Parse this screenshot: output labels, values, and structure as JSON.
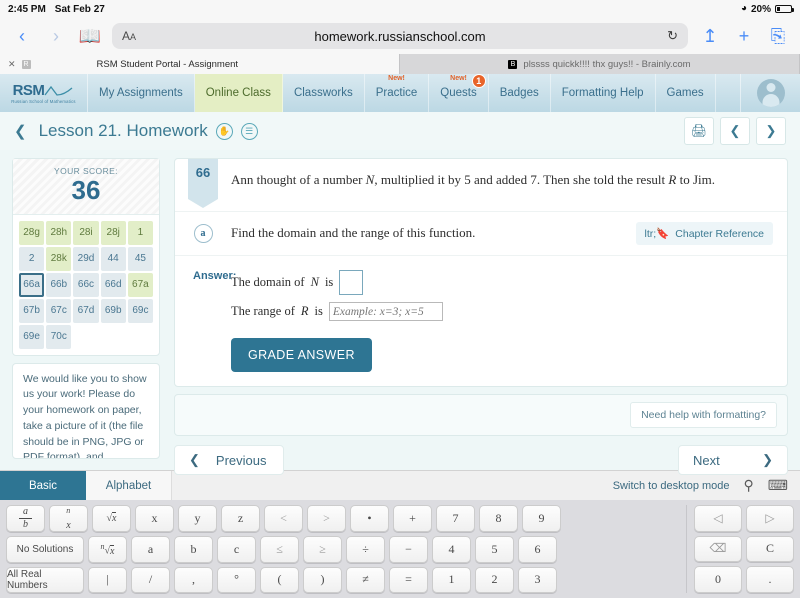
{
  "status_bar": {
    "time": "2:45 PM",
    "date": "Sat Feb 27",
    "wifi_icon": "wifi-icon",
    "battery_pct": "20%"
  },
  "browser": {
    "back_icon": "chevron-left-icon",
    "forward_icon": "chevron-right-icon",
    "bookmarks_icon": "book-icon",
    "aa_label": "AA",
    "url": "homework.russianschool.com",
    "reload_icon": "reload-icon",
    "share_icon": "share-icon",
    "new_tab_icon": "plus-icon",
    "tabs_icon": "tabs-icon",
    "tabs": [
      {
        "title": "RSM Student Portal - Assignment",
        "favicon": "R",
        "active": true,
        "close_icon": "close-icon"
      },
      {
        "title": "plssss quickk!!!! thx guys!! - Brainly.com",
        "favicon": "B",
        "active": false
      }
    ]
  },
  "site_nav": {
    "logo": {
      "text": "RSM",
      "subtitle": "Russian School of Mathematics"
    },
    "items": [
      {
        "label": "My Assignments",
        "active": false
      },
      {
        "label": "Online Class",
        "active": true
      },
      {
        "label": "Classworks",
        "active": false
      },
      {
        "label": "Practice",
        "active": false,
        "new_badge": "New!"
      },
      {
        "label": "Quests",
        "active": false,
        "new_badge": "New!",
        "count": "1"
      },
      {
        "label": "Badges",
        "active": false
      },
      {
        "label": "Formatting Help",
        "active": false
      },
      {
        "label": "Games",
        "active": false
      }
    ],
    "avatar": "user-avatar"
  },
  "lesson_header": {
    "back_icon": "chevron-left-icon",
    "title": "Lesson 21. Homework",
    "icon_hand": "hand-icon",
    "icon_book": "book-stack-icon",
    "print_icon": "printer-icon",
    "prev_icon": "chevron-left-icon",
    "next_icon": "chevron-right-icon"
  },
  "sidebar": {
    "score_label": "YOUR SCORE:",
    "score_value": "36",
    "grid": [
      {
        "label": "28g",
        "state": "done"
      },
      {
        "label": "28h",
        "state": "done"
      },
      {
        "label": "28i",
        "state": "done"
      },
      {
        "label": "28j",
        "state": "done"
      },
      {
        "label": "1",
        "state": "done"
      },
      {
        "label": "2",
        "state": "todo"
      },
      {
        "label": "28k",
        "state": "done"
      },
      {
        "label": "29d",
        "state": "todo"
      },
      {
        "label": "44",
        "state": "todo"
      },
      {
        "label": "45",
        "state": "todo"
      },
      {
        "label": "66a",
        "state": "todo",
        "selected": true
      },
      {
        "label": "66b",
        "state": "todo"
      },
      {
        "label": "66c",
        "state": "todo"
      },
      {
        "label": "66d",
        "state": "todo"
      },
      {
        "label": "67a",
        "state": "done"
      },
      {
        "label": "67b",
        "state": "todo"
      },
      {
        "label": "67c",
        "state": "todo"
      },
      {
        "label": "67d",
        "state": "todo"
      },
      {
        "label": "69b",
        "state": "todo"
      },
      {
        "label": "69c",
        "state": "todo"
      },
      {
        "label": "69e",
        "state": "todo"
      },
      {
        "label": "70c",
        "state": "todo"
      },
      {
        "label": "",
        "state": "empty"
      },
      {
        "label": "",
        "state": "empty"
      },
      {
        "label": "",
        "state": "empty"
      }
    ],
    "note": "We would like you to show us your work! Please do your homework on paper, take a picture of it (the file should be in PNG, JPG or PDF format), and"
  },
  "problem": {
    "number": "66",
    "statement_part1": "Ann thought of a number ",
    "statement_var1": "N",
    "statement_part2": ", multiplied it by 5 and added 7. Then she told the result ",
    "statement_var2": "R",
    "statement_part3": " to Jim.",
    "sub_letter": "a",
    "sub_text": "Find the domain and the range of this function.",
    "chapter_ref_label": "Chapter Reference",
    "chapter_ref_icon": "bookmark-icon"
  },
  "answer": {
    "label": "Answer:",
    "line1_prefix": "The domain of ",
    "line1_var": "N",
    "line1_suffix": " is",
    "line1_value": "",
    "line2_prefix": "The range of ",
    "line2_var": "R",
    "line2_suffix": " is",
    "line2_value": "",
    "line2_placeholder": "Example: x=3; x=5",
    "grade_button": "GRADE ANSWER"
  },
  "footer": {
    "help_button": "Need help with formatting?",
    "previous": "Previous",
    "next": "Next",
    "prev_icon": "chevron-left-icon",
    "next_icon": "chevron-right-icon"
  },
  "keyboard": {
    "tabs": [
      {
        "label": "Basic",
        "active": true
      },
      {
        "label": "Alphabet",
        "active": false
      }
    ],
    "desktop_link": "Switch to desktop mode",
    "search_icon": "magnifier-icon",
    "hide_keyboard_icon": "keyboard-down-icon",
    "rows": [
      [
        {
          "label": "a/b",
          "type": "fraction",
          "name": "fraction-key"
        },
        {
          "label": "x^n",
          "type": "power",
          "name": "power-key"
        },
        {
          "label": "√x",
          "type": "sqrt",
          "name": "sqrt-key"
        },
        {
          "label": "x",
          "name": "x-key"
        },
        {
          "label": "y",
          "name": "y-key"
        },
        {
          "label": "z",
          "name": "z-key"
        },
        {
          "label": "<",
          "name": "less-than-key",
          "dim": true
        },
        {
          "label": ">",
          "name": "greater-than-key",
          "dim": true
        },
        {
          "label": "•",
          "name": "multiply-dot-key"
        },
        {
          "label": "+",
          "name": "plus-key"
        },
        {
          "label": "7",
          "name": "digit-7-key"
        },
        {
          "label": "8",
          "name": "digit-8-key"
        },
        {
          "label": "9",
          "name": "digit-9-key"
        }
      ],
      [
        {
          "label": "No Solutions",
          "wide": true,
          "name": "no-solutions-key"
        },
        {
          "label": "ⁿ√x",
          "type": "nthroot",
          "name": "nth-root-key"
        },
        {
          "label": "a",
          "name": "a-key"
        },
        {
          "label": "b",
          "name": "b-key"
        },
        {
          "label": "c",
          "name": "c-key"
        },
        {
          "label": "≤",
          "name": "less-equal-key",
          "dim": true
        },
        {
          "label": "≥",
          "name": "greater-equal-key",
          "dim": true
        },
        {
          "label": "÷",
          "name": "divide-key"
        },
        {
          "label": "−",
          "name": "minus-key"
        },
        {
          "label": "4",
          "name": "digit-4-key"
        },
        {
          "label": "5",
          "name": "digit-5-key"
        },
        {
          "label": "6",
          "name": "digit-6-key"
        }
      ],
      [
        {
          "label": "All Real Numbers",
          "wide": true,
          "name": "all-real-numbers-key"
        },
        {
          "label": "|",
          "name": "pipe-key"
        },
        {
          "label": "/",
          "name": "slash-key"
        },
        {
          "label": ",",
          "name": "comma-key"
        },
        {
          "label": "°",
          "name": "degree-key"
        },
        {
          "label": "(",
          "name": "left-paren-key"
        },
        {
          "label": ")",
          "name": "right-paren-key"
        },
        {
          "label": "≠",
          "name": "not-equal-key"
        },
        {
          "label": "=",
          "name": "equals-key"
        },
        {
          "label": "1",
          "name": "digit-1-key"
        },
        {
          "label": "2",
          "name": "digit-2-key"
        },
        {
          "label": "3",
          "name": "digit-3-key"
        }
      ]
    ],
    "side_keys": [
      {
        "label": "◁",
        "name": "cursor-left-key",
        "dim": true
      },
      {
        "label": "▷",
        "name": "cursor-right-key",
        "dim": true
      },
      {
        "label": "⌫",
        "name": "backspace-key",
        "dim": true
      },
      {
        "label": "C",
        "name": "clear-key"
      },
      {
        "label": "0",
        "name": "digit-0-key"
      },
      {
        "label": ".",
        "name": "decimal-point-key"
      }
    ]
  }
}
